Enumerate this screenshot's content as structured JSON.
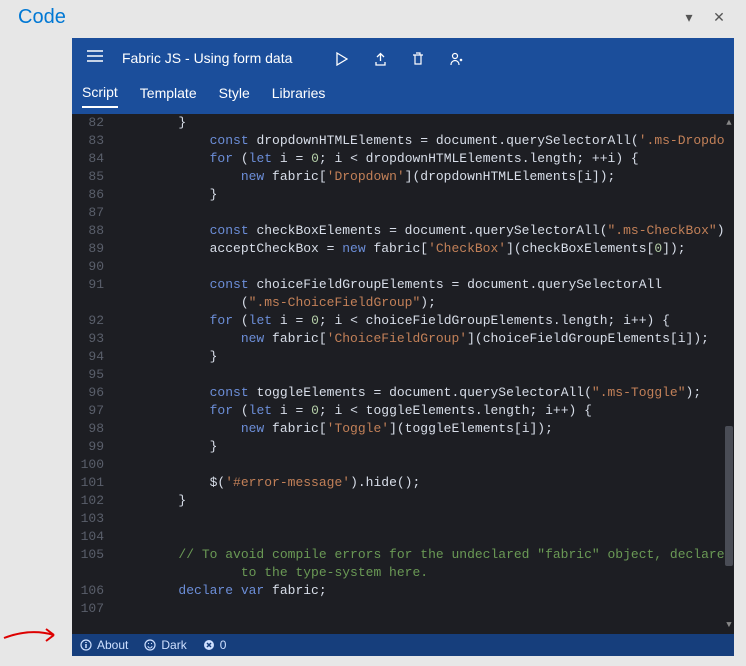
{
  "app": {
    "title": "Code"
  },
  "toolbar": {
    "project_title": "Fabric JS - Using form data"
  },
  "tabs": {
    "items": [
      {
        "label": "Script",
        "active": true
      },
      {
        "label": "Template",
        "active": false
      },
      {
        "label": "Style",
        "active": false
      },
      {
        "label": "Libraries",
        "active": false
      }
    ]
  },
  "status": {
    "about": "About",
    "theme": "Dark",
    "errors": "0"
  },
  "code": {
    "first_line": 82,
    "lines": [
      {
        "n": 82,
        "ind": 2,
        "tokens": [
          [
            "op",
            "}"
          ]
        ]
      },
      {
        "n": 83,
        "ind": 3,
        "tokens": [
          [
            "kw",
            "const"
          ],
          [
            "op",
            " dropdownHTMLElements = document.querySelectorAll("
          ],
          [
            "str",
            "'.ms-Dropdown'"
          ],
          [
            "op",
            ");"
          ]
        ]
      },
      {
        "n": 84,
        "ind": 3,
        "tokens": [
          [
            "kw",
            "for"
          ],
          [
            "op",
            " ("
          ],
          [
            "kw",
            "let"
          ],
          [
            "op",
            " i = "
          ],
          [
            "num",
            "0"
          ],
          [
            "op",
            "; i < dropdownHTMLElements.length; ++i) {"
          ]
        ]
      },
      {
        "n": 85,
        "ind": 4,
        "tokens": [
          [
            "kw",
            "new"
          ],
          [
            "op",
            " fabric["
          ],
          [
            "str",
            "'Dropdown'"
          ],
          [
            "op",
            "](dropdownHTMLElements[i]);"
          ]
        ]
      },
      {
        "n": 86,
        "ind": 3,
        "tokens": [
          [
            "op",
            "}"
          ]
        ]
      },
      {
        "n": 87,
        "ind": 0,
        "tokens": []
      },
      {
        "n": 88,
        "ind": 3,
        "tokens": [
          [
            "kw",
            "const"
          ],
          [
            "op",
            " checkBoxElements = document.querySelectorAll("
          ],
          [
            "str",
            "\".ms-CheckBox\""
          ],
          [
            "op",
            ");"
          ]
        ]
      },
      {
        "n": 89,
        "ind": 3,
        "tokens": [
          [
            "op",
            "acceptCheckBox = "
          ],
          [
            "kw",
            "new"
          ],
          [
            "op",
            " fabric["
          ],
          [
            "str",
            "'CheckBox'"
          ],
          [
            "op",
            "](checkBoxElements["
          ],
          [
            "num",
            "0"
          ],
          [
            "op",
            "]);"
          ]
        ]
      },
      {
        "n": 90,
        "ind": 0,
        "tokens": []
      },
      {
        "n": 91,
        "ind": 3,
        "tokens": [
          [
            "kw",
            "const"
          ],
          [
            "op",
            " choiceFieldGroupElements = document.querySelectorAll"
          ]
        ]
      },
      {
        "n": "",
        "ind": 4,
        "tokens": [
          [
            "op",
            "("
          ],
          [
            "str",
            "\".ms-ChoiceFieldGroup\""
          ],
          [
            "op",
            ");"
          ]
        ]
      },
      {
        "n": 92,
        "ind": 3,
        "tokens": [
          [
            "kw",
            "for"
          ],
          [
            "op",
            " ("
          ],
          [
            "kw",
            "let"
          ],
          [
            "op",
            " i = "
          ],
          [
            "num",
            "0"
          ],
          [
            "op",
            "; i < choiceFieldGroupElements.length; i++) {"
          ]
        ]
      },
      {
        "n": 93,
        "ind": 4,
        "tokens": [
          [
            "kw",
            "new"
          ],
          [
            "op",
            " fabric["
          ],
          [
            "str",
            "'ChoiceFieldGroup'"
          ],
          [
            "op",
            "](choiceFieldGroupElements[i]);"
          ]
        ]
      },
      {
        "n": 94,
        "ind": 3,
        "tokens": [
          [
            "op",
            "}"
          ]
        ]
      },
      {
        "n": 95,
        "ind": 0,
        "tokens": []
      },
      {
        "n": 96,
        "ind": 3,
        "tokens": [
          [
            "kw",
            "const"
          ],
          [
            "op",
            " toggleElements = document.querySelectorAll("
          ],
          [
            "str",
            "\".ms-Toggle\""
          ],
          [
            "op",
            ");"
          ]
        ]
      },
      {
        "n": 97,
        "ind": 3,
        "tokens": [
          [
            "kw",
            "for"
          ],
          [
            "op",
            " ("
          ],
          [
            "kw",
            "let"
          ],
          [
            "op",
            " i = "
          ],
          [
            "num",
            "0"
          ],
          [
            "op",
            "; i < toggleElements.length; i++) {"
          ]
        ]
      },
      {
        "n": 98,
        "ind": 4,
        "tokens": [
          [
            "kw",
            "new"
          ],
          [
            "op",
            " fabric["
          ],
          [
            "str",
            "'Toggle'"
          ],
          [
            "op",
            "](toggleElements[i]);"
          ]
        ]
      },
      {
        "n": 99,
        "ind": 3,
        "tokens": [
          [
            "op",
            "}"
          ]
        ]
      },
      {
        "n": 100,
        "ind": 0,
        "tokens": []
      },
      {
        "n": 101,
        "ind": 3,
        "tokens": [
          [
            "op",
            "$("
          ],
          [
            "str",
            "'#error-message'"
          ],
          [
            "op",
            ").hide();"
          ]
        ]
      },
      {
        "n": 102,
        "ind": 2,
        "tokens": [
          [
            "op",
            "}"
          ]
        ]
      },
      {
        "n": 103,
        "ind": 0,
        "tokens": []
      },
      {
        "n": 104,
        "ind": 0,
        "tokens": []
      },
      {
        "n": 105,
        "ind": 2,
        "tokens": [
          [
            "cmt",
            "// To avoid compile errors for the undeclared \"fabric\" object, declare it"
          ]
        ]
      },
      {
        "n": "",
        "ind": 4,
        "tokens": [
          [
            "cmt",
            "to the type-system here."
          ]
        ]
      },
      {
        "n": 106,
        "ind": 2,
        "tokens": [
          [
            "kw",
            "declare var"
          ],
          [
            "op",
            " fabric;"
          ]
        ]
      },
      {
        "n": 107,
        "ind": 0,
        "tokens": []
      }
    ]
  }
}
